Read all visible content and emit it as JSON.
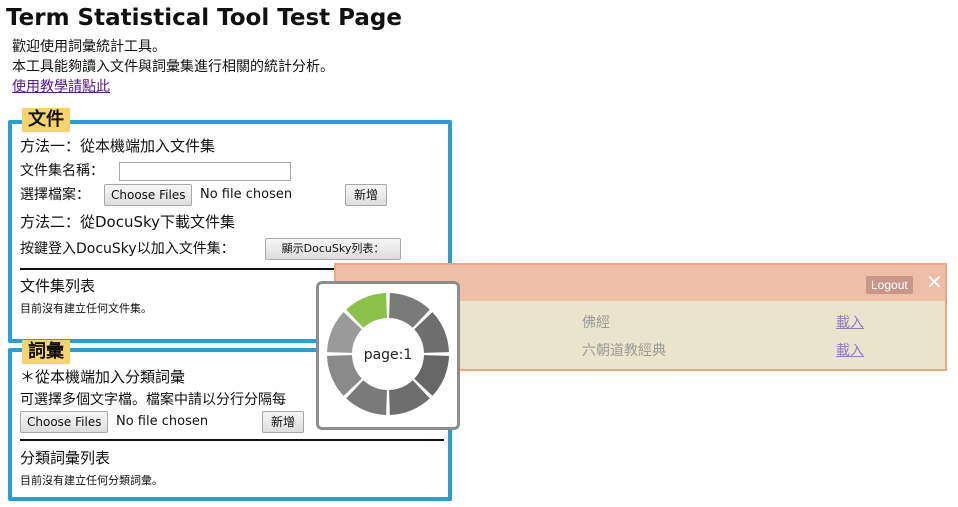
{
  "page": {
    "title": "Term Statistical Tool Test Page",
    "intro_line1": "歡迎使用詞彙統計工具。",
    "intro_line2": "本工具能夠讀入文件與詞彙集進行相關的統計分析。",
    "tutorial_link": "使用教學請點此"
  },
  "docs_panel": {
    "tag": "文件",
    "method1_title": "方法一：從本機端加入文件集",
    "name_label": "文件集名稱：",
    "file_label": "選擇檔案：",
    "choose_files": "Choose Files",
    "no_file": "No file chosen",
    "add_button": "新增",
    "method2_title": "方法二：從DocuSky下載文件集",
    "login_hint": "按鍵登入DocuSky以加入文件集：",
    "show_list_button": "顯示DocuSky列表：",
    "list_title": "文件集列表",
    "empty_note": "目前沒有建立任何文件集。"
  },
  "vocab_panel": {
    "tag": "詞彙",
    "method_title": "＊從本機端加入分類詞彙",
    "hint": "可選擇多個文字檔。檔案中請以分行分隔每",
    "choose_files": "Choose Files",
    "no_file": "No file chosen",
    "add_button": "新增",
    "list_title": "分類詞彙列表",
    "empty_note": "目前沒有建立任何分類詞彙。"
  },
  "overlay": {
    "logout": "Logout",
    "rows": [
      {
        "name": "佛經",
        "action": "載入"
      },
      {
        "name": "六朝道教經典",
        "action": "載入"
      }
    ]
  },
  "loader": {
    "text": "page:1",
    "progress_segments": 8,
    "active_segment": 1,
    "active_color": "#8bc34a"
  },
  "colors": {
    "panel_border": "#24a0d6",
    "tag_bg": "#f6d46a",
    "overlay_border": "#f0a47f"
  }
}
